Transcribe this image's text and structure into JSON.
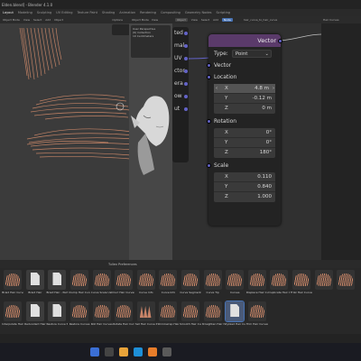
{
  "app": {
    "title": "Elden.blend] - Blender 4.1.0",
    "menu": [
      "File",
      "Edit",
      "Render",
      "Window",
      "Help"
    ],
    "workspaces": [
      "Layout",
      "Modeling",
      "Sculpting",
      "UV Editing",
      "Texture Paint",
      "Shading",
      "Animation",
      "Rendering",
      "Compositing",
      "Geometry Nodes",
      "Scripting"
    ]
  },
  "viewport": {
    "header_items": [
      "Object Mode",
      "View",
      "Select",
      "Add",
      "Object"
    ],
    "options_label": "Options"
  },
  "mid_panel": {
    "header_items": [
      "Object Mode",
      "View"
    ],
    "lines": [
      "User Perspective",
      "(6) Collection",
      "10 Centimeters"
    ]
  },
  "node_editor": {
    "header_items": [
      "Object",
      "View",
      "Select",
      "Add",
      "Node"
    ],
    "node_tree_name": "hair_curve_to_hair_curve",
    "side_node_rows": [
      "ted",
      "mal",
      "UV",
      "ctor",
      "era",
      "ow",
      "ut"
    ],
    "node": {
      "title": "Vector",
      "type_label": "Type:",
      "type_value": "Point",
      "vector_label": "Vector",
      "location_label": "Location",
      "location": [
        {
          "axis": "X",
          "value": "4.8 m"
        },
        {
          "axis": "Y",
          "value": "-0.12 m"
        },
        {
          "axis": "Z",
          "value": "0 m"
        }
      ],
      "rotation_label": "Rotation",
      "rotation": [
        {
          "axis": "X",
          "value": "0°"
        },
        {
          "axis": "Y",
          "value": "0°"
        },
        {
          "axis": "Z",
          "value": "180°"
        }
      ],
      "scale_label": "Scale",
      "scale": [
        {
          "axis": "X",
          "value": "0.110"
        },
        {
          "axis": "Y",
          "value": "0.840"
        },
        {
          "axis": "Z",
          "value": "1.000"
        }
      ]
    }
  },
  "rightbar": {
    "label": "Hair Curves"
  },
  "asset_browser": {
    "header": "Tullex Preferences",
    "items": [
      {
        "label": "Braid Hair Curves",
        "kind": "hair"
      },
      {
        "label": "Braid Hair",
        "kind": "doc"
      },
      {
        "label": "Braid Hair - Perfect",
        "kind": "doc"
      },
      {
        "label": "Clump Hair Curves",
        "kind": "hair"
      },
      {
        "label": "Curve Scale Ushape",
        "kind": "hair"
      },
      {
        "label": "Curl Hair Curves",
        "kind": "hair"
      },
      {
        "label": "Curve Info",
        "kind": "hair"
      },
      {
        "label": "Curve Info",
        "kind": "hair"
      },
      {
        "label": "Curve Segment",
        "kind": "hair"
      },
      {
        "label": "Curve Tip",
        "kind": "hair"
      },
      {
        "label": "Curves",
        "kind": "hair"
      },
      {
        "label": "Displace Hair Curves",
        "kind": "hair"
      },
      {
        "label": "Duplicate Hair Curves",
        "kind": "hair"
      },
      {
        "label": "Frizz Hair Curves",
        "kind": "hair"
      },
      {
        "label": "",
        "kind": "hair"
      },
      {
        "label": "",
        "kind": "hair"
      },
      {
        "label": "Interpolate Hair Curves",
        "kind": "hair"
      },
      {
        "label": "Redundant Hair",
        "kind": "doc"
      },
      {
        "label": "Restore Curve Segments",
        "kind": "doc"
      },
      {
        "label": "Restore Curves",
        "kind": "hair"
      },
      {
        "label": "Roll Hair Curves",
        "kind": "hair"
      },
      {
        "label": "Rotate Hair Curves",
        "kind": "hair"
      },
      {
        "label": "Set Hair Curve Profile",
        "kind": "spikes"
      },
      {
        "label": "Shrinkwrap Hair Curves",
        "kind": "hair"
      },
      {
        "label": "Smooth Hair Curves",
        "kind": "hair"
      },
      {
        "label": "Straighten Hair Curves",
        "kind": "hair"
      },
      {
        "label": "Stylized Hair Curves",
        "kind": "sel"
      },
      {
        "label": "Trim Hair Curves",
        "kind": "hair"
      }
    ]
  },
  "colors": {
    "accent": "#4772b3",
    "socket_vector": "#6363c7",
    "node_header": "#5a3a6a",
    "hair": "#d08a6a"
  }
}
